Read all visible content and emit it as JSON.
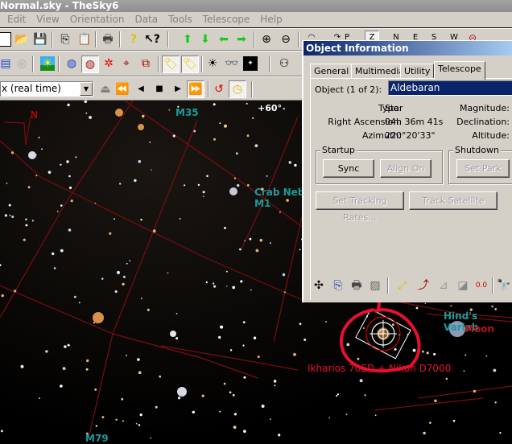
{
  "window": {
    "title": "Normal.sky - TheSky6"
  },
  "menu": [
    "Edit",
    "View",
    "Orientation",
    "Data",
    "Tools",
    "Telescope",
    "Help"
  ],
  "toolbar": {
    "time_mode": "x (real time)",
    "compass": [
      "P",
      "Z",
      "N",
      "E",
      "S",
      "W"
    ]
  },
  "sky": {
    "labels": {
      "m35": "M35",
      "dec_60": "+60°",
      "north": "N",
      "crab_nebula": "Crab Neb",
      "m1": "M1",
      "hinds_variable": "Hind's Variab",
      "moon": "Moon",
      "telescope_fov": "Ikharios 70ED + Nikon D7000",
      "m79": "M79"
    }
  },
  "dialog": {
    "title": "Object Information",
    "tabs": [
      "General",
      "Multimedia",
      "Utility",
      "Telescope"
    ],
    "active_tab": "Telescope",
    "object_label": "Object (1 of 2):",
    "object_value": "Aldebaran",
    "fields": {
      "type_label": "Type:",
      "type_value": "Star",
      "ra_label": "Right Ascension:",
      "ra_value": "04h 36m 41s",
      "az_label": "Azimuth:",
      "az_value": "220°20'33\"",
      "mag_label": "Magnitude:",
      "dec_label": "Declination:",
      "alt_label": "Altitude:"
    },
    "startup": {
      "legend": "Startup",
      "sync": "Sync",
      "align_on": "Align On"
    },
    "shutdown": {
      "legend": "Shutdown",
      "set_park": "Set Park"
    },
    "set_tracking_rates": "Set Tracking Rates...",
    "track_satellite": "Track Satellite"
  },
  "colors": {
    "accent_annotation": "#e8102c",
    "grid": "#8a0f12",
    "label_teal": "#1a9a9a",
    "label_red": "#b5151a"
  }
}
